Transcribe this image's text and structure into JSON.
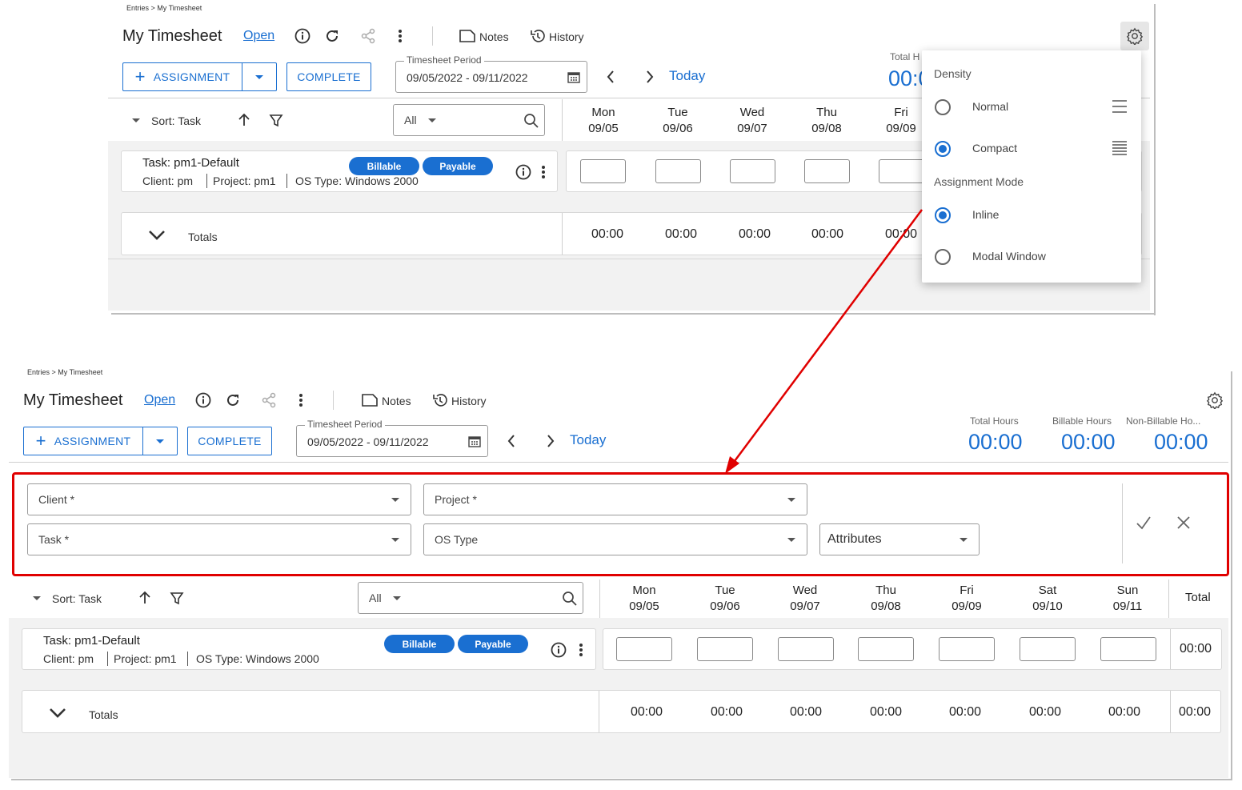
{
  "breadcrumb": "Entries > My Timesheet",
  "title": "My Timesheet",
  "status_link": "Open",
  "toolbar": {
    "notes": "Notes",
    "history": "History"
  },
  "actions": {
    "assignment": "ASSIGNMENT",
    "complete": "COMPLETE"
  },
  "period": {
    "label": "Timesheet Period",
    "value": "09/05/2022 - 09/11/2022"
  },
  "nav": {
    "today": "Today"
  },
  "hours": [
    {
      "label": "Total Hours",
      "value": "00:00"
    },
    {
      "label": "Billable Hours",
      "value": "00:00"
    },
    {
      "label": "Non-Billable Ho...",
      "value": "00:00"
    }
  ],
  "top_partial": {
    "total_label": "Total H",
    "total_value": "00:0"
  },
  "sort": {
    "label": "Sort: Task",
    "filter_value": "All"
  },
  "days": [
    {
      "name": "Mon",
      "date": "09/05"
    },
    {
      "name": "Tue",
      "date": "09/06"
    },
    {
      "name": "Wed",
      "date": "09/07"
    },
    {
      "name": "Thu",
      "date": "09/08"
    },
    {
      "name": "Fri",
      "date": "09/09"
    },
    {
      "name": "Sat",
      "date": "09/10"
    },
    {
      "name": "Sun",
      "date": "09/11"
    }
  ],
  "total_header": "Total",
  "task": {
    "title": "Task: pm1-Default",
    "client": "Client: pm",
    "project": "Project: pm1",
    "os": "OS Type: Windows 2000",
    "chips": [
      "Billable",
      "Payable"
    ],
    "total": "00:00"
  },
  "totals": {
    "label": "Totals",
    "values": [
      "00:00",
      "00:00",
      "00:00",
      "00:00",
      "00:00",
      "00:00",
      "00:00"
    ],
    "grand": "00:00",
    "partial_fri": "00:00"
  },
  "settings_menu": {
    "density_header": "Density",
    "density_options": [
      "Normal",
      "Compact"
    ],
    "density_selected": "Compact",
    "mode_header": "Assignment Mode",
    "mode_options": [
      "Inline",
      "Modal Window"
    ],
    "mode_selected": "Inline"
  },
  "inline_form": {
    "client": "Client *",
    "project": "Project *",
    "task": "Task *",
    "os_type": "OS Type",
    "attributes": "Attributes"
  },
  "colors": {
    "accent": "#1a6fd1",
    "highlight": "#e00000"
  }
}
